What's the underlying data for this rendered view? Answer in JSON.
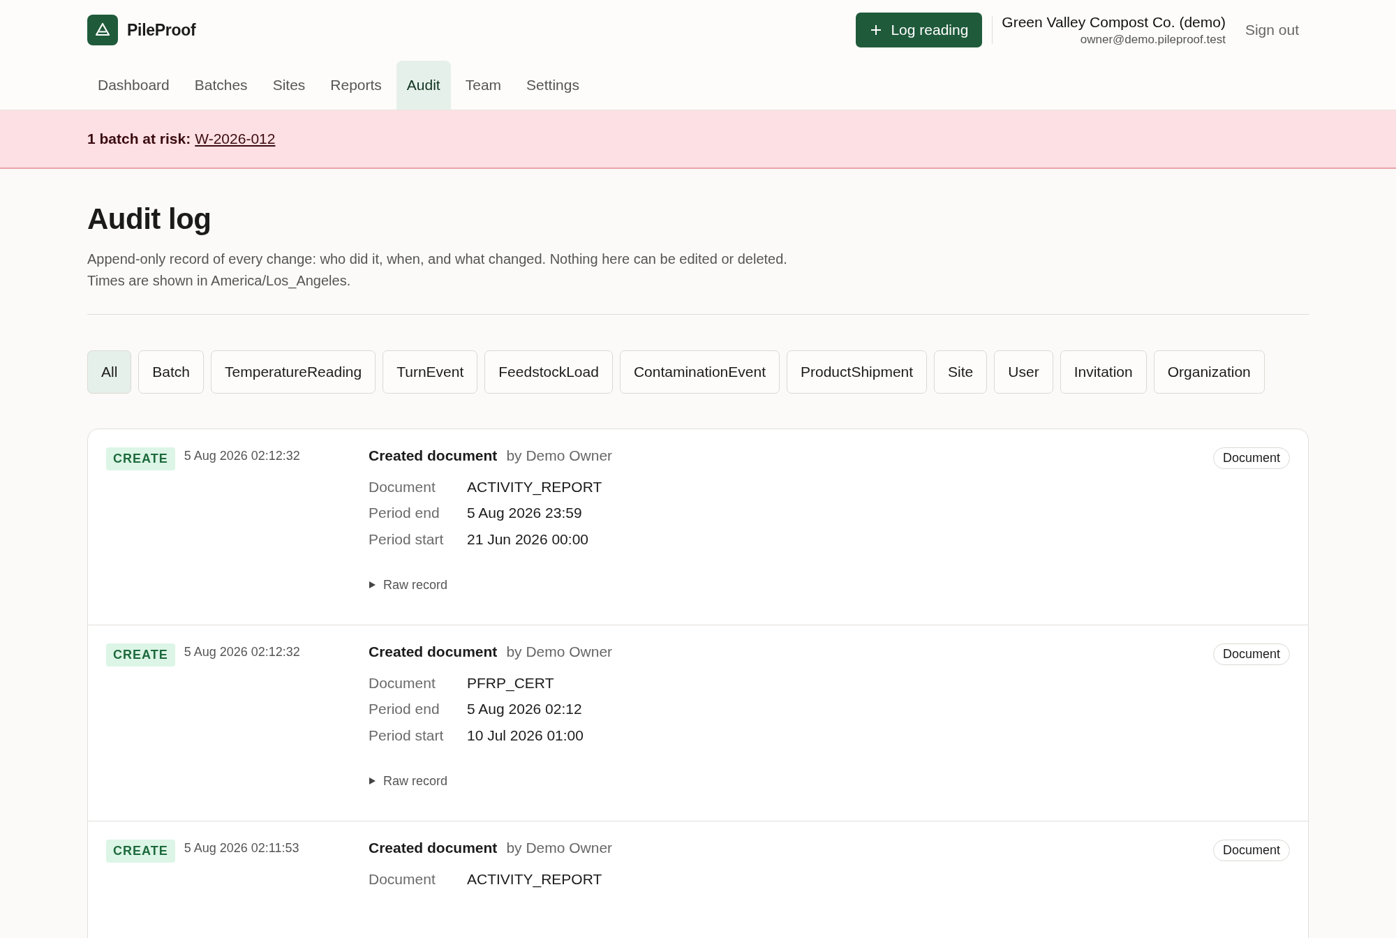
{
  "app": {
    "name": "PileProof"
  },
  "header": {
    "action": "Log reading",
    "org_name": "Green Valley Compost Co. (demo)",
    "email": "owner@demo.pileproof.test",
    "sign_out": "Sign out"
  },
  "nav": [
    {
      "label": "Dashboard",
      "selected": false
    },
    {
      "label": "Batches",
      "selected": false
    },
    {
      "label": "Sites",
      "selected": false
    },
    {
      "label": "Reports",
      "selected": false
    },
    {
      "label": "Audit",
      "selected": true
    },
    {
      "label": "Team",
      "selected": false
    },
    {
      "label": "Settings",
      "selected": false
    }
  ],
  "alert": {
    "label": "1 batch at risk:",
    "link": "W-2026-012"
  },
  "page": {
    "title": "Audit log",
    "description": "Append-only record of every change: who did it, when, and what changed. Nothing here can be edited or deleted. Times are shown in America/Los_Angeles."
  },
  "filters": [
    {
      "label": "All",
      "selected": true
    },
    {
      "label": "Batch",
      "selected": false
    },
    {
      "label": "TemperatureReading",
      "selected": false
    },
    {
      "label": "TurnEvent",
      "selected": false
    },
    {
      "label": "FeedstockLoad",
      "selected": false
    },
    {
      "label": "ContaminationEvent",
      "selected": false
    },
    {
      "label": "ProductShipment",
      "selected": false
    },
    {
      "label": "Site",
      "selected": false
    },
    {
      "label": "User",
      "selected": false
    },
    {
      "label": "Invitation",
      "selected": false
    },
    {
      "label": "Organization",
      "selected": false
    }
  ],
  "entries": [
    {
      "action": "CREATE",
      "time": "5 Aug 2026 02:12:32",
      "summary": "Created document",
      "actor": "by Demo Owner",
      "entity": "Document",
      "fields": [
        {
          "label": "Document",
          "value": "ACTIVITY_REPORT"
        },
        {
          "label": "Period end",
          "value": "5 Aug 2026 23:59"
        },
        {
          "label": "Period start",
          "value": "21 Jun 2026 00:00"
        }
      ],
      "raw": "Raw record"
    },
    {
      "action": "CREATE",
      "time": "5 Aug 2026 02:12:32",
      "summary": "Created document",
      "actor": "by Demo Owner",
      "entity": "Document",
      "fields": [
        {
          "label": "Document",
          "value": "PFRP_CERT"
        },
        {
          "label": "Period end",
          "value": "5 Aug 2026 02:12"
        },
        {
          "label": "Period start",
          "value": "10 Jul 2026 01:00"
        }
      ],
      "raw": "Raw record"
    },
    {
      "action": "CREATE",
      "time": "5 Aug 2026 02:11:53",
      "summary": "Created document",
      "actor": "by Demo Owner",
      "entity": "Document",
      "fields": [
        {
          "label": "Document",
          "value": "ACTIVITY_REPORT"
        }
      ]
    }
  ]
}
